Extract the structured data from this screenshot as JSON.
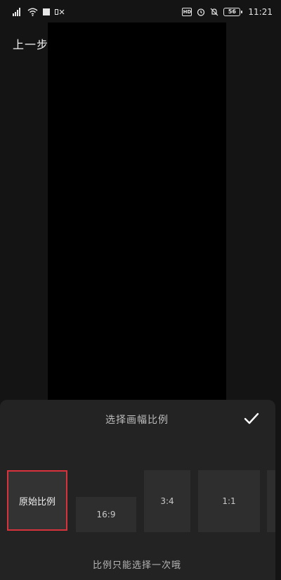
{
  "status_bar": {
    "time": "11:21",
    "battery": "56",
    "hd_badge": "HD",
    "signal_prefix": "⁺ᵈ"
  },
  "header": {
    "back_label": "上一步"
  },
  "panel": {
    "title": "选择画幅比例",
    "hint": "比例只能选择一次哦",
    "ratios": [
      {
        "label": "原始比例",
        "selected": true
      },
      {
        "label": "16:9",
        "selected": false
      },
      {
        "label": "3:4",
        "selected": false
      },
      {
        "label": "1:1",
        "selected": false
      }
    ]
  },
  "colors": {
    "accent": "#d8323c",
    "panel_bg": "#232323",
    "preview_bg": "#000000"
  }
}
